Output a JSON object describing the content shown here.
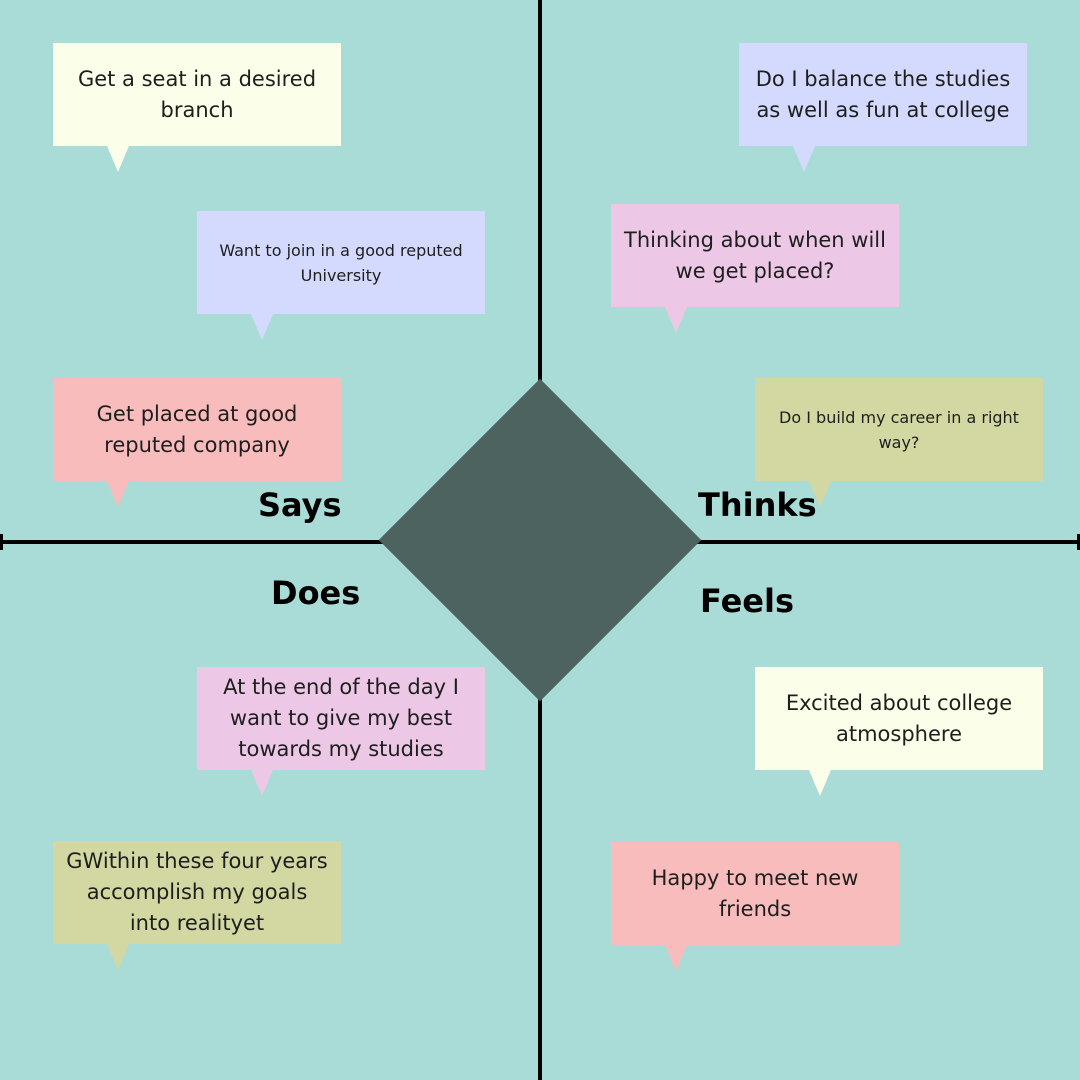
{
  "colors": {
    "background": "#aadcd7",
    "diamond": "#4d6360",
    "lines": "#000000",
    "note_yellow": "#fbfee8",
    "note_lavender": "#d4dafd",
    "note_pink": "#f8bcbd",
    "note_mauve": "#ecc8e6",
    "note_olive": "#d3d8a2"
  },
  "quadrants": {
    "says": {
      "label": "Says",
      "notes": [
        {
          "text": "Get a seat in a desired branch",
          "color": "note_yellow"
        },
        {
          "text": "Want to join in a good reputed University",
          "color": "note_lavender"
        },
        {
          "text": "Get placed at good reputed company",
          "color": "note_pink"
        }
      ]
    },
    "thinks": {
      "label": "Thinks",
      "notes": [
        {
          "text": "Do I balance the studies as well as fun at college",
          "color": "note_lavender"
        },
        {
          "text": "Thinking about when will we get placed?",
          "color": "note_mauve"
        },
        {
          "text": "Do I build my career in a right way?",
          "color": "note_olive"
        }
      ]
    },
    "does": {
      "label": "Does",
      "notes": [
        {
          "text": "At the end of the day I want to give my best towards my studies",
          "color": "note_mauve"
        },
        {
          "text": "GWithin these four years accomplish my goals into realityet",
          "color": "note_olive"
        }
      ]
    },
    "feels": {
      "label": "Feels",
      "notes": [
        {
          "text": "Excited about college atmosphere",
          "color": "note_yellow"
        },
        {
          "text": "Happy to meet new friends",
          "color": "note_pink"
        }
      ]
    }
  }
}
